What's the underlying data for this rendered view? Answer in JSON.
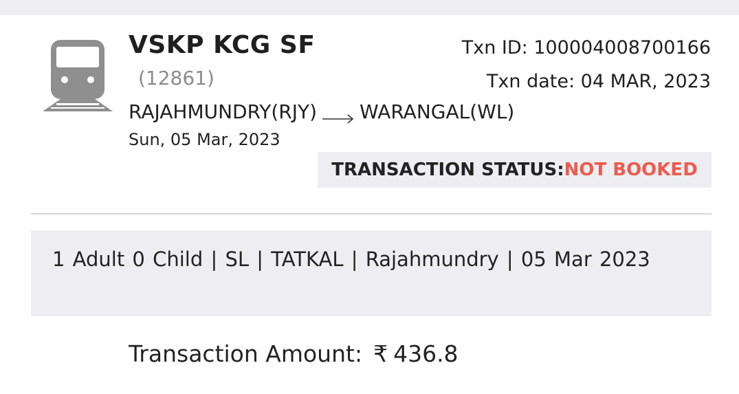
{
  "train": {
    "icon": "train-icon",
    "name": "VSKP KCG SF",
    "number": "(12861)",
    "from": "RAJAHMUNDRY(RJY)",
    "to": "WARANGAL(WL)",
    "route_arrow_icon": "arrow-right-icon",
    "journey_date": "Sun, 05 Mar, 2023"
  },
  "transaction": {
    "id_text": "Txn ID: 100004008700166",
    "date_text": "Txn date: 04 MAR, 2023",
    "status_label": "TRANSACTION STATUS:",
    "status_value": "NOT BOOKED",
    "status_color": "#ec5b4e",
    "amount_label": "Transaction Amount:",
    "currency_symbol": "₹",
    "amount_value": "436.8"
  },
  "summary": {
    "text": "1 Adult 0 Child  | SL | TATKAL | Rajahmundry | 05 Mar 2023"
  },
  "colors": {
    "panel_background": "#eeeef2",
    "icon_gray": "#8f8f8f",
    "divider": "#d6d6d6"
  }
}
